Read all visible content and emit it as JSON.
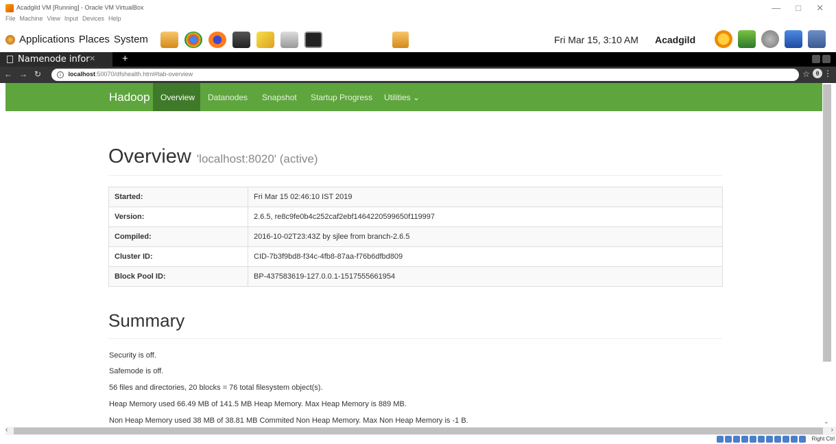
{
  "vbox": {
    "title": "Acadgild VM [Running] - Oracle VM VirtualBox",
    "menu": [
      "File",
      "Machine",
      "View",
      "Input",
      "Devices",
      "Help"
    ],
    "right_ctrl": "Right Ctrl"
  },
  "gnome_panel": {
    "menu": [
      "Applications",
      "Places",
      "System"
    ],
    "clock": "Fri Mar 15,  3:10 AM",
    "user": "Acadgild"
  },
  "browser": {
    "tab_title": "Namenode infor",
    "new_tab": "+",
    "url_host": "localhost",
    "url_rest": ":50070/dfshealth.html#tab-overview",
    "profile_initial": "θ"
  },
  "navbar": {
    "brand": "Hadoop",
    "items": [
      "Overview",
      "Datanodes",
      "Snapshot",
      "Startup Progress",
      "Utilities ⌄"
    ]
  },
  "overview": {
    "title": "Overview",
    "subtitle": "'localhost:8020' (active)",
    "rows": [
      {
        "key": "Started:",
        "value": "Fri Mar 15 02:46:10 IST 2019"
      },
      {
        "key": "Version:",
        "value": "2.6.5, re8c9fe0b4c252caf2ebf1464220599650f119997"
      },
      {
        "key": "Compiled:",
        "value": "2016-10-02T23:43Z by sjlee from branch-2.6.5"
      },
      {
        "key": "Cluster ID:",
        "value": "CID-7b3f9bd8-f34c-4fb8-87aa-f76b6dfbd809"
      },
      {
        "key": "Block Pool ID:",
        "value": "BP-437583619-127.0.0.1-1517555661954"
      }
    ]
  },
  "summary": {
    "title": "Summary",
    "lines": [
      "Security is off.",
      "Safemode is off.",
      "56 files and directories, 20 blocks = 76 total filesystem object(s).",
      "Heap Memory used 66.49 MB of 141.5 MB Heap Memory. Max Heap Memory is 889 MB.",
      "Non Heap Memory used 38 MB of 38.81 MB Commited Non Heap Memory. Max Non Heap Memory is -1 B."
    ]
  },
  "colors": {
    "navbar": "#5ea53e",
    "navbar_active": "#3f7a2a"
  }
}
